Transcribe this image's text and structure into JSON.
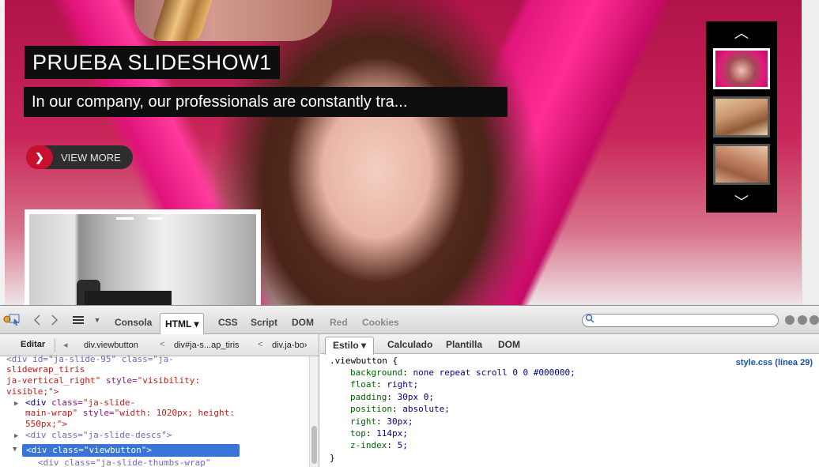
{
  "slideshow": {
    "title": "PRUEBA SLIDESHOW1",
    "description": "In our company, our professionals are constantly tra...",
    "view_more_label": "VIEW MORE",
    "view_more_arrow": "❯",
    "thumb_up": "︿",
    "thumb_down": "﹀"
  },
  "devtools": {
    "toolbar_tabs": [
      {
        "label": "Consola",
        "state": "normal"
      },
      {
        "label": "HTML ▾",
        "state": "active"
      },
      {
        "label": "CSS",
        "state": "normal"
      },
      {
        "label": "Script",
        "state": "normal"
      },
      {
        "label": "DOM",
        "state": "normal"
      },
      {
        "label": "Red",
        "state": "disabled"
      },
      {
        "label": "Cookies",
        "state": "disabled"
      }
    ],
    "edit_label": "Editar",
    "breadcrumbs": [
      "div.viewbutton",
      "div#ja-s...ap_tiris",
      "div.ja-bo›"
    ],
    "side_tabs": [
      "Estilo ▾",
      "Calculado",
      "Plantilla",
      "DOM"
    ],
    "html_tree": {
      "line1": "<div id=\"ja-slide-95\" class=\"ja-",
      "line2": "slidewrap_tiris",
      "line3_class": "ja-vertical_right\"",
      "line3_style_attr": " style=",
      "line3_style_val": "\"visibility:",
      "line4": "visible;\">",
      "wrap_tag": "<div ",
      "wrap_attr": "class=",
      "wrap_val": "\"ja-slide-",
      "wrap_line2_val": "main-wrap\"",
      "wrap_line2_attr": " style=",
      "wrap_line2_val2": "\"width: 1020px; height:",
      "wrap_line3": "550px;\">",
      "descs_line": "<div class=\"ja-slide-descs\">",
      "selected": "<div class=\"viewbutton\">",
      "cut_line": "<div class=\"ja-slide-thumbs-wrap\""
    },
    "css": {
      "selector": ".viewbutton {",
      "source": "style.css (línea 29)",
      "rules": [
        {
          "prop": "background",
          "value": "none repeat scroll 0 0 #000000;"
        },
        {
          "prop": "float",
          "value": "right;"
        },
        {
          "prop": "padding",
          "value": "30px 0;"
        },
        {
          "prop": "position",
          "value": "absolute;"
        },
        {
          "prop": "right",
          "value": "30px;"
        },
        {
          "prop": "top",
          "value": "114px;"
        },
        {
          "prop": "z-index",
          "value": "5;"
        }
      ],
      "closing": "}"
    }
  },
  "colors": {
    "accent_red": "#c8102e",
    "selection_blue": "#3875d7",
    "slide_pink": "#e0167a"
  },
  "icons": [
    "inspect-icon",
    "pointer-select-icon",
    "back-arrow-icon",
    "forward-arrow-icon",
    "list-icon",
    "dropdown-icon",
    "search-icon",
    "minimize-icon",
    "restore-icon",
    "close-icon",
    "chevron-up-icon",
    "chevron-down-icon"
  ]
}
